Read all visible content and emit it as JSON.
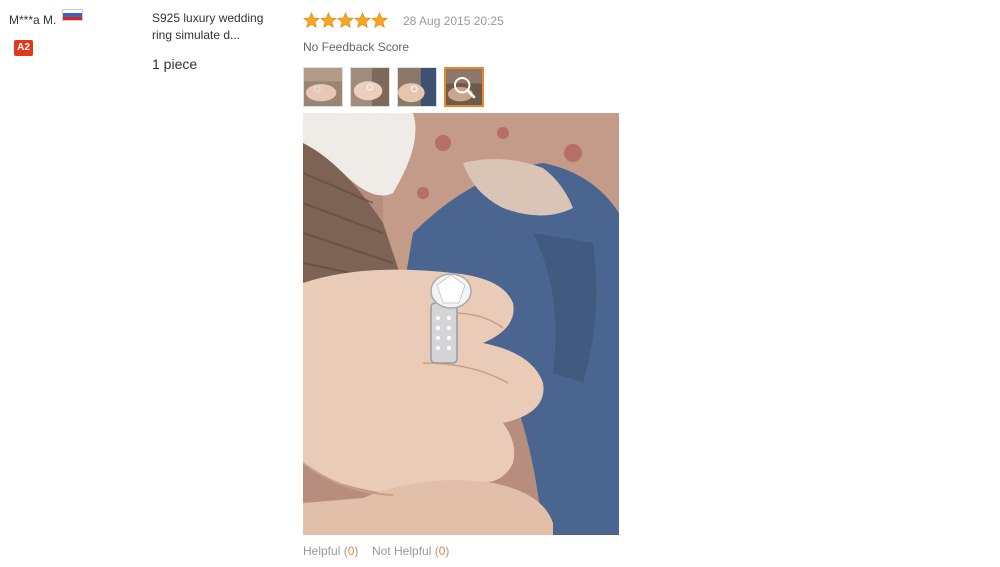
{
  "reviewer": {
    "name": "M***a M.",
    "flag_icon": "russia-flag-icon",
    "level_badge": "A2",
    "badge_color": "#e0381e"
  },
  "product": {
    "title": "S925 luxury wedding ring simulate d...",
    "quantity": "1 piece"
  },
  "review": {
    "rating_stars": 5,
    "star_icon": "star-icon",
    "star_color": "#f6a623",
    "date": "28 Aug 2015 20:25",
    "feedback_label": "No Feedback Score",
    "thumbnail_count": 4,
    "active_thumbnail": 4,
    "zoom_icon": "magnifier-icon"
  },
  "votes": {
    "helpful_label": "Helpful",
    "helpful_count": "0",
    "not_helpful_label": "Not Helpful",
    "not_helpful_count": "0",
    "accent_color": "#e8872e"
  }
}
